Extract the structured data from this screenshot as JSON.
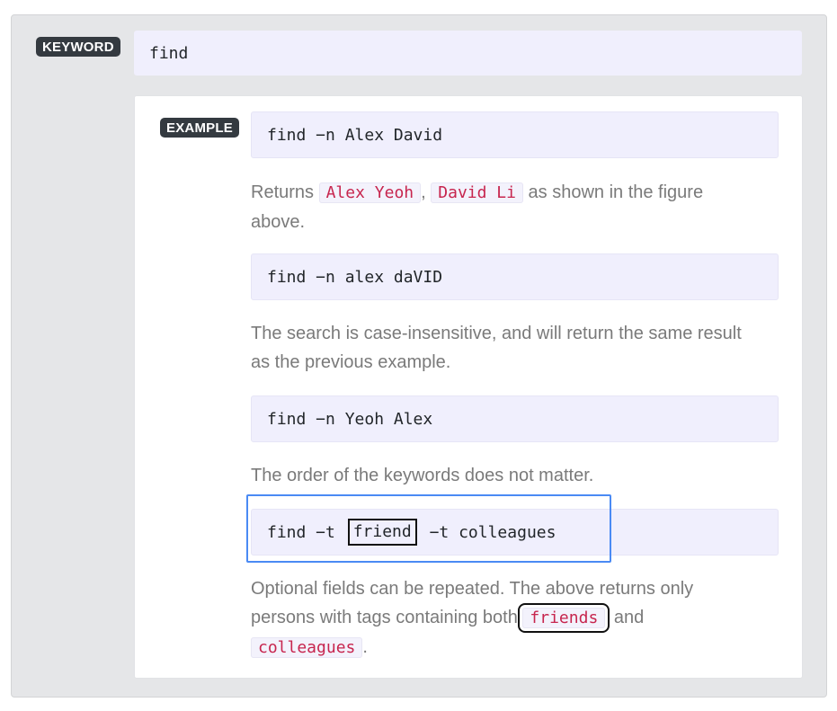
{
  "keyword": {
    "badge": "KEYWORD",
    "value": "find"
  },
  "example": {
    "badge": "EXAMPLE",
    "items": [
      {
        "command": "find −n Alex David",
        "desc_before": "Returns ",
        "code1": "Alex Yeoh",
        "sep": ", ",
        "code2": "David Li",
        "desc_after": " as shown in the figure above."
      },
      {
        "command": "find −n alex daVID",
        "desc": "The search is case-insensitive, and will return the same result as the previous example."
      },
      {
        "command": "find −n Yeoh Alex",
        "desc": "The order of the keywords does not matter."
      },
      {
        "command_before": "find −t ",
        "command_boxed": "friend",
        "command_after": " −t colleagues",
        "desc_before": "Optional fields can be repeated. The above returns only persons with tags containing both ",
        "code1": "friends",
        "desc_mid": " and",
        "code2": "colleagues",
        "desc_after": "."
      }
    ]
  },
  "colors": {
    "badge_bg": "#343a40",
    "code_bg": "#f0effd",
    "inline_code_text": "#c7254e",
    "highlight_border": "#4a8af4",
    "outer_bg": "#e5e6e8"
  }
}
